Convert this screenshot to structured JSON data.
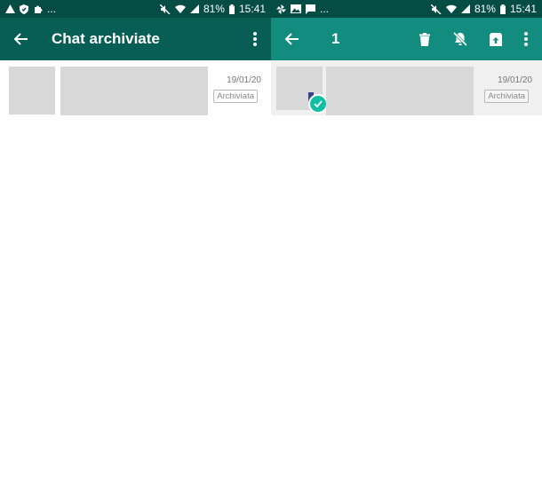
{
  "colors": {
    "status_bar": "#054d44",
    "appbar_left": "#075e54",
    "appbar_right_selection": "#128c7e",
    "check_accent": "#0dbfa5",
    "placeholder": "#d8d8d8",
    "selected_row_bg": "#f0f0f0"
  },
  "left": {
    "status": {
      "ellipsis": "...",
      "battery": "81%",
      "time": "15:41"
    },
    "appbar": {
      "title": "Chat archiviate"
    },
    "chat": {
      "date": "19/01/20",
      "badge": "Archiviata"
    }
  },
  "right": {
    "status": {
      "ellipsis": "...",
      "battery": "81%",
      "time": "15:41"
    },
    "appbar": {
      "selected_count": "1"
    },
    "chat": {
      "date": "19/01/20",
      "badge": "Archiviata"
    }
  },
  "icons": {
    "back": "arrow-left",
    "overflow": "dots-vertical",
    "delete": "trash",
    "mute": "bell-off",
    "unarchive": "archive-up",
    "selected": "check-circle"
  }
}
